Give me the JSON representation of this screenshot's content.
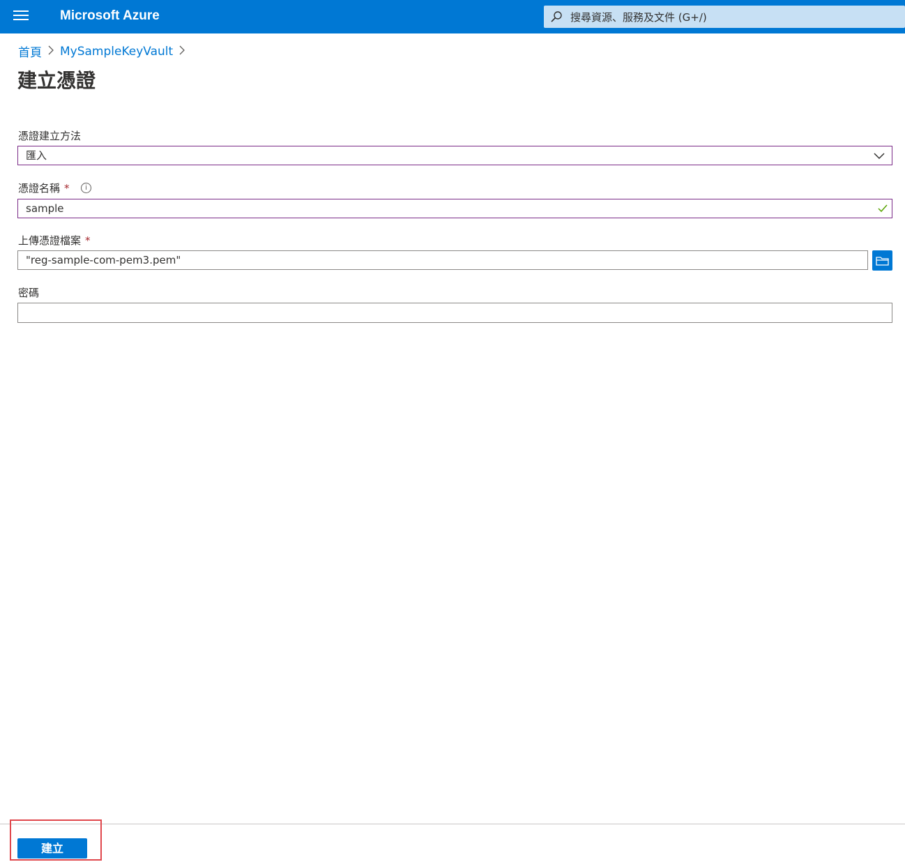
{
  "header": {
    "brand": "Microsoft Azure",
    "search_placeholder": "搜尋資源、服務及文件 (G+/)"
  },
  "breadcrumb": [
    "首頁",
    "MySampleKeyVault"
  ],
  "page_title": "建立憑證",
  "form": {
    "method_label": "憑證建立方法",
    "method_value": "匯入",
    "name_label": "憑證名稱",
    "name_value": "sample",
    "upload_label": "上傳憑證檔案",
    "upload_value": "\"reg-sample-com-pem3.pem\"",
    "password_label": "密碼",
    "password_value": "",
    "required_marker": "*"
  },
  "footer": {
    "create_label": "建立"
  },
  "colors": {
    "accent": "#0078d4",
    "focus_border": "#7b2b88",
    "required": "#a4262c",
    "valid": "#57a300",
    "highlight": "#e0474c"
  }
}
